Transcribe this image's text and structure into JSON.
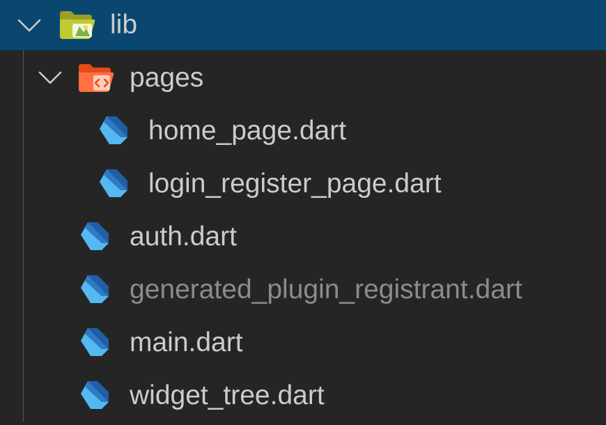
{
  "explorer": {
    "root_folder": {
      "label": "lib",
      "icon": "folder-open-lib-icon",
      "expanded": true,
      "selected": true
    },
    "pages_folder": {
      "label": "pages",
      "icon": "folder-open-pages-icon",
      "expanded": true
    },
    "files": {
      "home_page": {
        "label": "home_page.dart",
        "icon": "dart-file-icon"
      },
      "login_register_page": {
        "label": "login_register_page.dart",
        "icon": "dart-file-icon"
      },
      "auth": {
        "label": "auth.dart",
        "icon": "dart-file-icon"
      },
      "generated_plugin_registrant": {
        "label": "generated_plugin_registrant.dart",
        "icon": "dart-file-icon",
        "dimmed": true
      },
      "main": {
        "label": "main.dart",
        "icon": "dart-file-icon"
      },
      "widget_tree": {
        "label": "widget_tree.dart",
        "icon": "dart-file-icon"
      }
    },
    "colors": {
      "background": "#252526",
      "selection": "#094771",
      "text": "#cccccc",
      "dimmed_text": "#8c8c8c",
      "dart_light": "#54b9f0",
      "dart_dark": "#1e5fa8",
      "folder_lib": "#c0ca33",
      "folder_pages": "#ff7043"
    }
  }
}
